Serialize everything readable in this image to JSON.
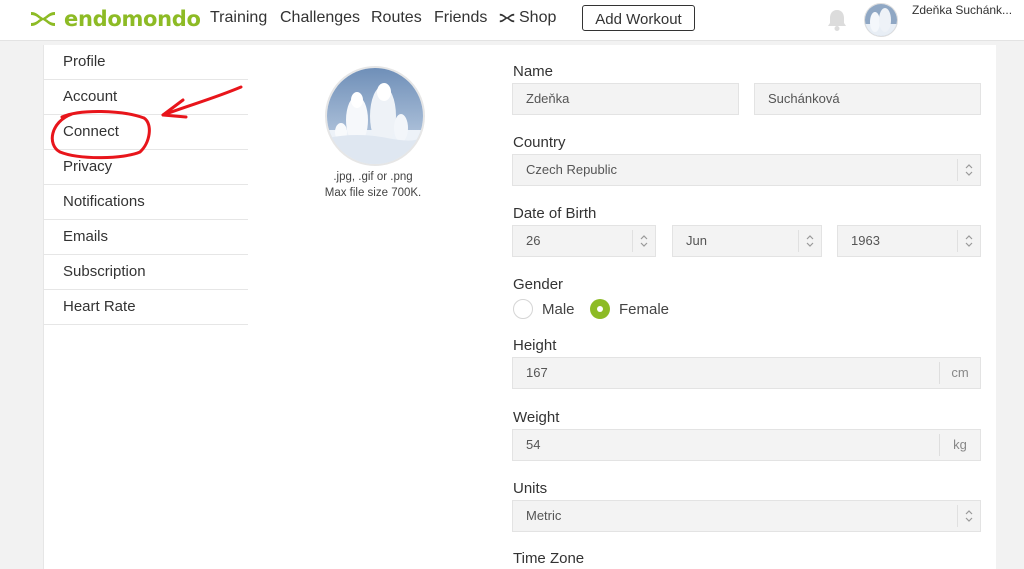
{
  "header": {
    "brand": "endomondo",
    "nav": [
      "Training",
      "Challenges",
      "Routes",
      "Friends",
      "Shop"
    ],
    "add_workout": "Add Workout",
    "user_name": "Zdeňka Suchánk..."
  },
  "sidebar": {
    "items": [
      "Profile",
      "Account",
      "Connect",
      "Privacy",
      "Notifications",
      "Emails",
      "Subscription",
      "Heart Rate"
    ]
  },
  "profile": {
    "upload_hint_line1": ".jpg, .gif or .png",
    "upload_hint_line2": "Max file size 700K.",
    "name_label": "Name",
    "first_name": "Zdeňka",
    "last_name": "Suchánková",
    "country_label": "Country",
    "country": "Czech Republic",
    "dob_label": "Date of Birth",
    "dob_day": "26",
    "dob_month": "Jun",
    "dob_year": "1963",
    "gender_label": "Gender",
    "gender_male": "Male",
    "gender_female": "Female",
    "gender_selected": "Female",
    "height_label": "Height",
    "height": "167",
    "height_unit": "cm",
    "weight_label": "Weight",
    "weight": "54",
    "weight_unit": "kg",
    "units_label": "Units",
    "units": "Metric",
    "timezone_label": "Time Zone"
  },
  "colors": {
    "brand": "#8dbb25",
    "annotation": "#e8151b"
  }
}
